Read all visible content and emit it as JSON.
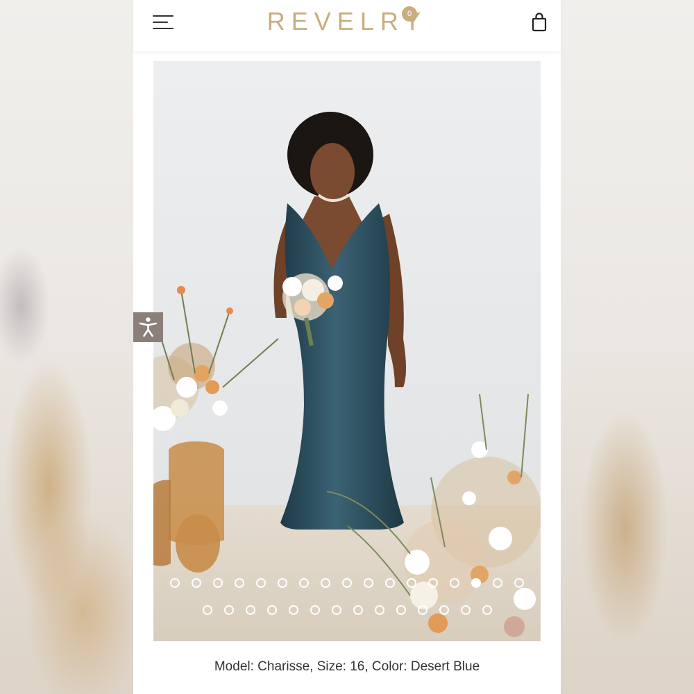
{
  "brand": {
    "logo_text": "REVELRY",
    "color": "#c9ad7e"
  },
  "header": {
    "menu_icon": "hamburger-menu-icon",
    "cart_icon": "shopping-bag-icon",
    "cart_count": "0"
  },
  "accessibility": {
    "icon": "accessibility-person-icon"
  },
  "gallery": {
    "dress_color": "#2f4f5e",
    "row1_dot_count": 17,
    "row2_dot_count": 14,
    "active_dot_row": 1,
    "active_dot_index": 14
  },
  "caption": {
    "text": "Model: Charisse, Size: 16, Color: Desert Blue"
  }
}
